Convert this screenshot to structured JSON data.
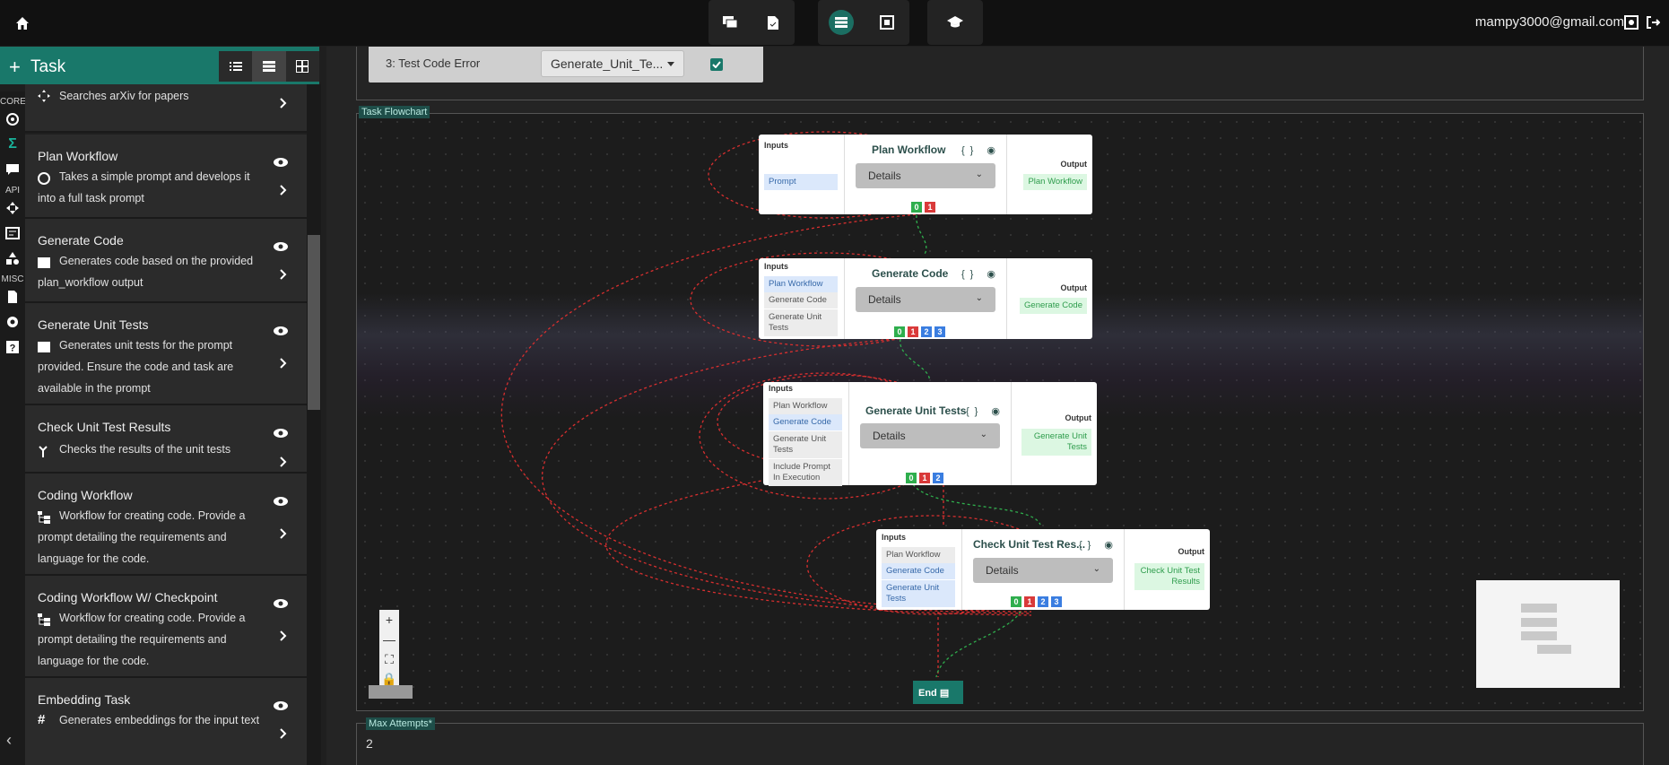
{
  "user": {
    "email": "mampy3000@gmail.com"
  },
  "task_panel": {
    "title": "Task",
    "rail_labels": [
      "CORE",
      "API",
      "MISC"
    ],
    "items": [
      {
        "name": "",
        "desc": "Searches arXiv for papers"
      },
      {
        "name": "Plan Workflow",
        "desc": "Takes a simple prompt and develops it into a full task prompt"
      },
      {
        "name": "Generate Code",
        "desc": "Generates code based on the provided plan_workflow output"
      },
      {
        "name": "Generate Unit Tests",
        "desc": "Generates unit tests for the prompt provided. Ensure the code and task are available in the prompt"
      },
      {
        "name": "Check Unit Test Results",
        "desc": "Checks the results of the unit tests"
      },
      {
        "name": "Coding Workflow",
        "desc": "Workflow for creating code. Provide a prompt detailing the requirements and language for the code."
      },
      {
        "name": "Coding Workflow W/ Checkpoint",
        "desc": "Workflow for creating code. Provide a prompt detailing the requirements and language for the code."
      },
      {
        "name": "Embedding Task",
        "desc": "Generates embeddings for the input text"
      }
    ]
  },
  "test_code": {
    "label": "3: Test Code Error",
    "select_value": "Generate_Unit_Te..."
  },
  "flowchart": {
    "label": "Task Flowchart",
    "details_label": "Details",
    "inputs_label": "Inputs",
    "output_label": "Output",
    "nodes": [
      {
        "title": "Plan Workflow",
        "inputs": [
          "Prompt"
        ],
        "output": "Plan Workflow",
        "ports": [
          "0",
          "1"
        ]
      },
      {
        "title": "Generate Code",
        "inputs": [
          "Plan Workflow",
          "Generate Code",
          "Generate Unit Tests"
        ],
        "output": "Generate Code",
        "ports": [
          "0",
          "1",
          "2",
          "3"
        ]
      },
      {
        "title": "Generate Unit Tests",
        "inputs": [
          "Plan Workflow",
          "Generate Code",
          "Generate Unit Tests",
          "Include Prompt In Execution"
        ],
        "output": "Generate Unit Tests",
        "ports": [
          "0",
          "1",
          "2"
        ]
      },
      {
        "title": "Check Unit Test Res...",
        "inputs": [
          "Plan Workflow",
          "Generate Code",
          "Generate Unit Tests"
        ],
        "output": "Check Unit Test Results",
        "ports": [
          "0",
          "1",
          "2",
          "3"
        ]
      }
    ],
    "end_label": "End"
  },
  "max_attempts": {
    "label": "Max Attempts*",
    "value": "2"
  },
  "colors": {
    "accent": "#19786a",
    "port_success": "#2fae4d",
    "port_error": "#d93a3a",
    "port_other": "#3a7de0"
  }
}
